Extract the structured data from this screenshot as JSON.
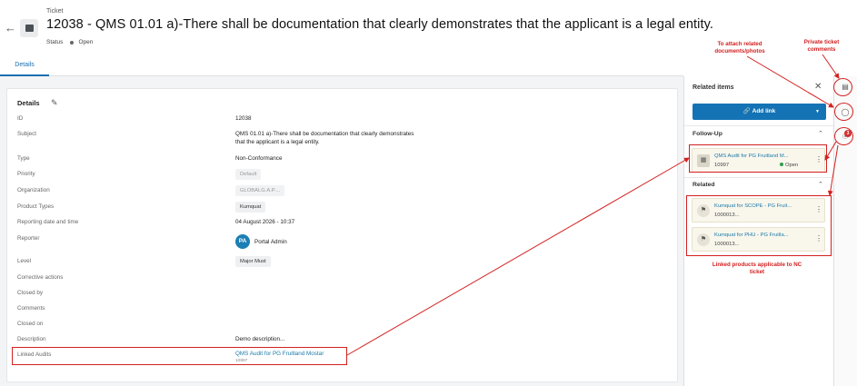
{
  "header": {
    "breadcrumb": "Ticket",
    "title": "12038 - QMS 01.01 a)-There shall be documentation that clearly demonstrates that the applicant is a legal entity.",
    "status_label": "Status",
    "status_value": "Open"
  },
  "tabs": [
    {
      "label": "Details"
    }
  ],
  "details": {
    "title": "Details",
    "rows": {
      "id": {
        "label": "ID",
        "value": "12038"
      },
      "subject": {
        "label": "Subject",
        "value_line1": "QMS 01.01 a)-There shall be documentation that clearly demonstrates",
        "value_line2": "that the applicant is a legal entity."
      },
      "type": {
        "label": "Type",
        "value": "Non-Conformance"
      },
      "priority": {
        "label": "Priority",
        "value": "Default"
      },
      "organization": {
        "label": "Organization",
        "value": "GLOBALG.A.P...."
      },
      "product_types": {
        "label": "Product Types",
        "value": "Kumquat"
      },
      "reporting_date": {
        "label": "Reporting date and time",
        "value": "04 August 2026 - 10:37"
      },
      "reporter": {
        "label": "Reporter",
        "initials": "PA",
        "value": "Portal Admin"
      },
      "level": {
        "label": "Level",
        "value": "Major Must"
      },
      "corrective_actions": {
        "label": "Corrective actions"
      },
      "closed_by": {
        "label": "Closed by"
      },
      "comments": {
        "label": "Comments"
      },
      "closed_on": {
        "label": "Closed on"
      },
      "description": {
        "label": "Description",
        "value": "Demo description..."
      },
      "linked_audits": {
        "label": "Linked Audits",
        "value": "QMS Audit for PG Fruitland Mostar",
        "sub": "10997"
      }
    }
  },
  "related_panel": {
    "title": "Related items",
    "add_link_label": "Add link",
    "follow_up": {
      "title": "Follow-Up",
      "items": [
        {
          "title": "QMS Audit for PG Fruitland M...",
          "id": "10997",
          "status": "Open"
        }
      ]
    },
    "related": {
      "title": "Related",
      "items": [
        {
          "title": "Kumquat for SCOPE - PG Fruit...",
          "id": "1000013..."
        },
        {
          "title": "Kumquat for PHU - PG Fruitla...",
          "id": "1000013..."
        }
      ]
    }
  },
  "sidebar": {
    "badge_count": "3"
  },
  "annotations": {
    "attach_docs": [
      "To attach related",
      "documents/photos"
    ],
    "private_comments": [
      "Private ticket",
      "comments"
    ],
    "linked_products": [
      "Linked products applicable to NC",
      "ticket"
    ]
  },
  "colors": {
    "accent": "#1473b4",
    "annotation": "#d32020",
    "link": "#1a7aa8"
  }
}
